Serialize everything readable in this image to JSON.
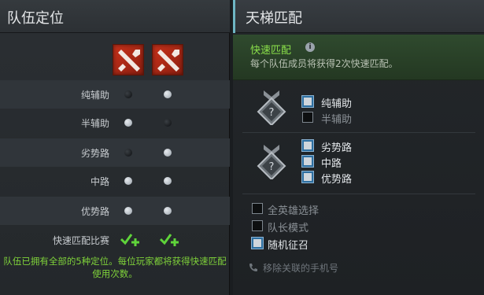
{
  "left_panel": {
    "title": "队伍定位",
    "avatars": [
      {
        "name": "dota2-logo-icon"
      },
      {
        "name": "dota2-logo-icon"
      }
    ],
    "roles": [
      {
        "label": "纯辅助",
        "player1": false,
        "player2": true
      },
      {
        "label": "半辅助",
        "player1": true,
        "player2": false
      },
      {
        "label": "劣势路",
        "player1": false,
        "player2": true
      },
      {
        "label": "中路",
        "player1": true,
        "player2": true
      },
      {
        "label": "优势路",
        "player1": true,
        "player2": true
      }
    ],
    "quick_match_label": "快速匹配比赛",
    "note": "队伍已拥有全部的5种定位。每位玩家都将获得快速匹配使用次数。"
  },
  "right_panel": {
    "title": "天梯匹配",
    "quick_match": {
      "title": "快速匹配",
      "info_glyph": "i",
      "description": "每个队伍成员将获得2次快速匹配。"
    },
    "support_group": [
      {
        "label": "纯辅助",
        "checked": true
      },
      {
        "label": "半辅助",
        "checked": false
      }
    ],
    "core_group": [
      {
        "label": "劣势路",
        "checked": true
      },
      {
        "label": "中路",
        "checked": true
      },
      {
        "label": "优势路",
        "checked": true
      }
    ],
    "general_options": [
      {
        "label": "全英雄选择",
        "checked": false
      },
      {
        "label": "队长模式",
        "checked": false
      },
      {
        "label": "随机征召",
        "checked": true
      }
    ],
    "phone_link": "移除关联的手机号"
  },
  "colors": {
    "accent_green": "#5fd43a",
    "accent_teal": "#6fb6c4",
    "note_green": "#7fd23a"
  }
}
